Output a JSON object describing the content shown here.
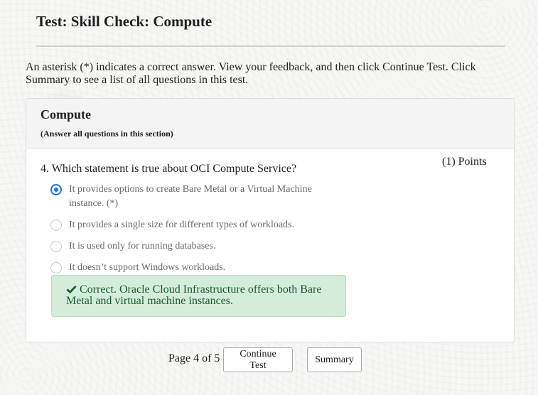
{
  "page": {
    "title": "Test: Skill Check: Compute",
    "instructions": "An asterisk (*) indicates a correct answer. View your feedback, and then click Continue Test. Click Summary to see a list of all questions in this test."
  },
  "section": {
    "title": "Compute",
    "note": "(Answer all questions in this section)"
  },
  "question": {
    "text": "4. Which statement is true about OCI Compute Service?",
    "points": "(1) Points",
    "options": [
      {
        "label": "It provides options to create Bare Metal or a Virtual Machine instance. (*)",
        "selected": true
      },
      {
        "label": "It provides a single size for different types of workloads.",
        "selected": false
      },
      {
        "label": "It is used only for running databases.",
        "selected": false
      },
      {
        "label": "It doesn’t support Windows workloads.",
        "selected": false
      }
    ],
    "feedback": "Correct. Oracle Cloud Infrastructure offers both Bare Metal and virtual machine instances."
  },
  "pager": {
    "text": "Page 4 of 5",
    "continue_label": "Continue Test",
    "summary_label": "Summary"
  },
  "icons": {
    "feedback": "check-icon",
    "selected_option": "radio-checked-icon",
    "option": "radio-icon"
  },
  "colors": {
    "accent": "#1a73e8",
    "feedback_background": "#d4edda",
    "feedback_text": "#1c5a2e"
  }
}
